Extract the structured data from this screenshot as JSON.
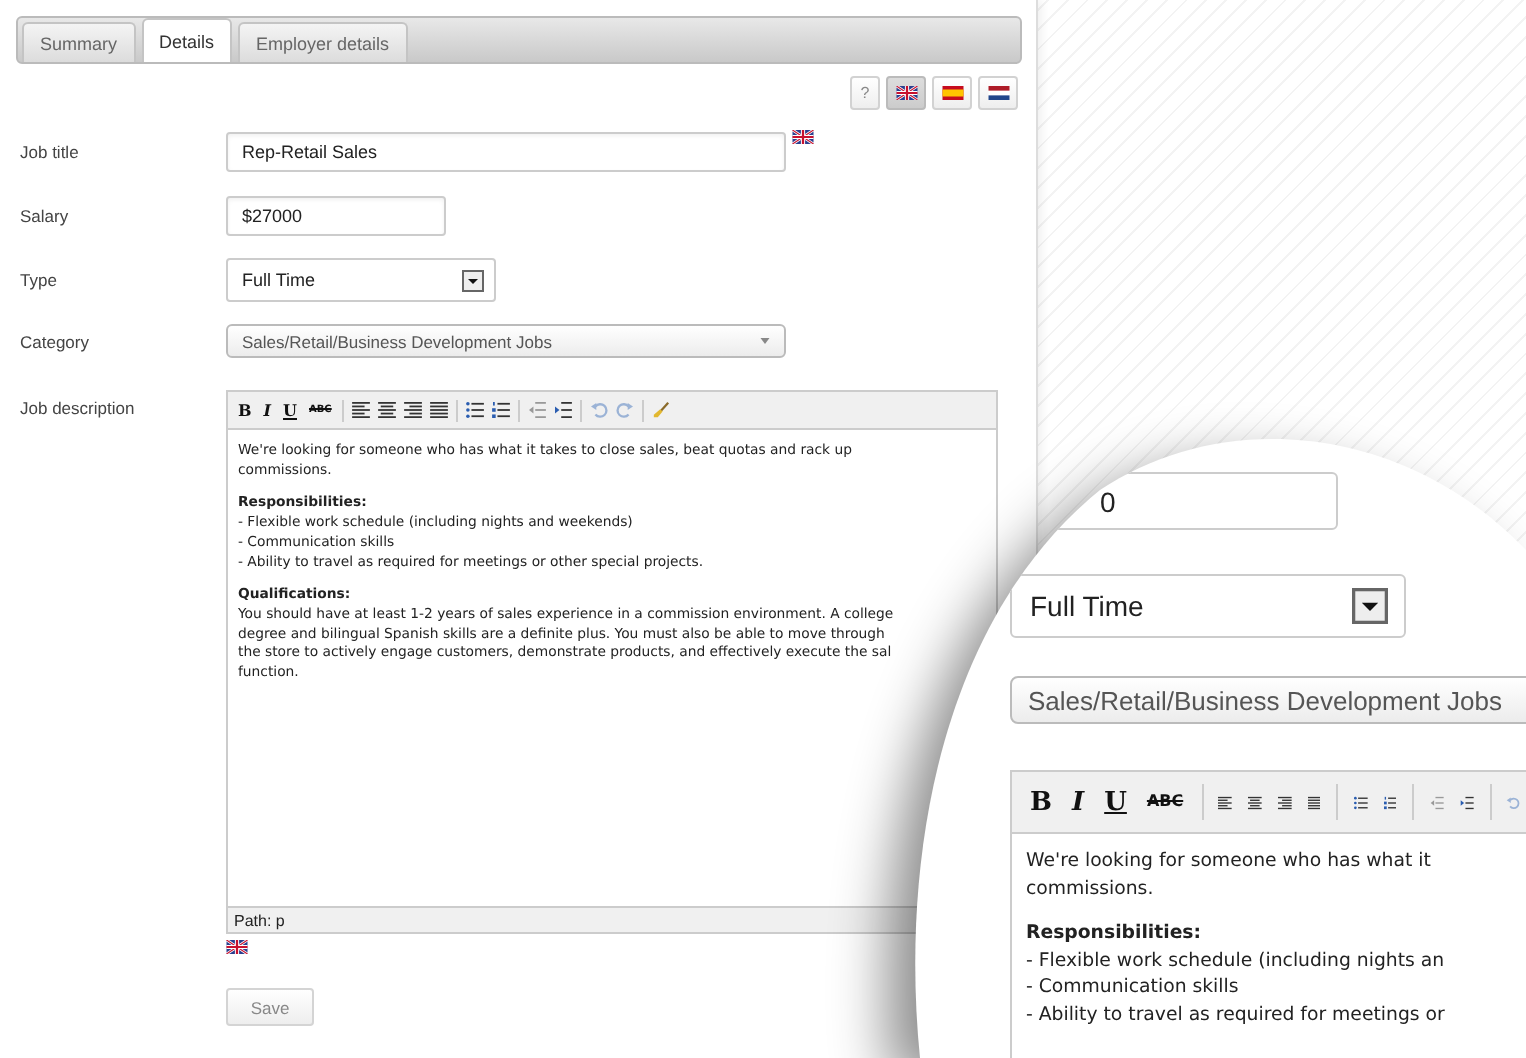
{
  "tabs": [
    {
      "label": "Summary",
      "selected": false
    },
    {
      "label": "Details",
      "selected": true
    },
    {
      "label": "Employer details",
      "selected": false
    }
  ],
  "language_bar": {
    "help": "?",
    "languages": [
      {
        "kind": "uk",
        "selected": true
      },
      {
        "kind": "es",
        "selected": false
      },
      {
        "kind": "nl",
        "selected": false
      }
    ]
  },
  "fields": [
    {
      "kind": "text",
      "label": "Job title",
      "value": "Rep-Retail Sales",
      "translatable": true
    },
    {
      "kind": "money",
      "label": "Salary",
      "value": "$27000",
      "translatable": false
    },
    {
      "kind": "select",
      "label": "Type",
      "value": "Full Time",
      "translatable": false
    },
    {
      "kind": "dropdown",
      "label": "Category",
      "value": "Sales/Retail/Business Development Jobs",
      "translatable": false
    }
  ],
  "editor": {
    "label": "Job description",
    "format_buttons": [
      "B",
      "I",
      "U",
      "ABC"
    ],
    "blocks": [
      {
        "lines": [
          "We're looking for someone who has what it takes to close sales, beat quotas and rack up",
          "commissions."
        ]
      },
      {
        "heading": "Responsibilities:",
        "lines": [
          "- Flexible work schedule (including nights and weekends)",
          "- Communication skills",
          "- Ability to travel as required for meetings or other special projects."
        ]
      },
      {
        "heading": "Qualifications:",
        "lines": [
          "You should have at least 1-2 years of sales experience in a commission environment. A college",
          "degree and bilingual Spanish skills are a definite plus. You must also be able to move through",
          "the store to actively engage customers, demonstrate products, and effectively execute the sal",
          "function."
        ]
      }
    ],
    "path": "Path: p",
    "translatable": true
  },
  "save_button": "Save",
  "magnifier": {
    "salary": "0",
    "type": "Full Time",
    "category": "Sales/Retail/Business Development Jobs",
    "format_buttons": [
      "B",
      "I",
      "U",
      "ABC"
    ],
    "blocks": [
      {
        "lines": [
          "We're looking for someone who has what it",
          "commissions."
        ]
      },
      {
        "heading": "Responsibilities:",
        "lines": [
          "- Flexible work schedule (including nights an",
          "- Communication skills",
          "- Ability to travel as required for meetings or"
        ]
      }
    ]
  }
}
